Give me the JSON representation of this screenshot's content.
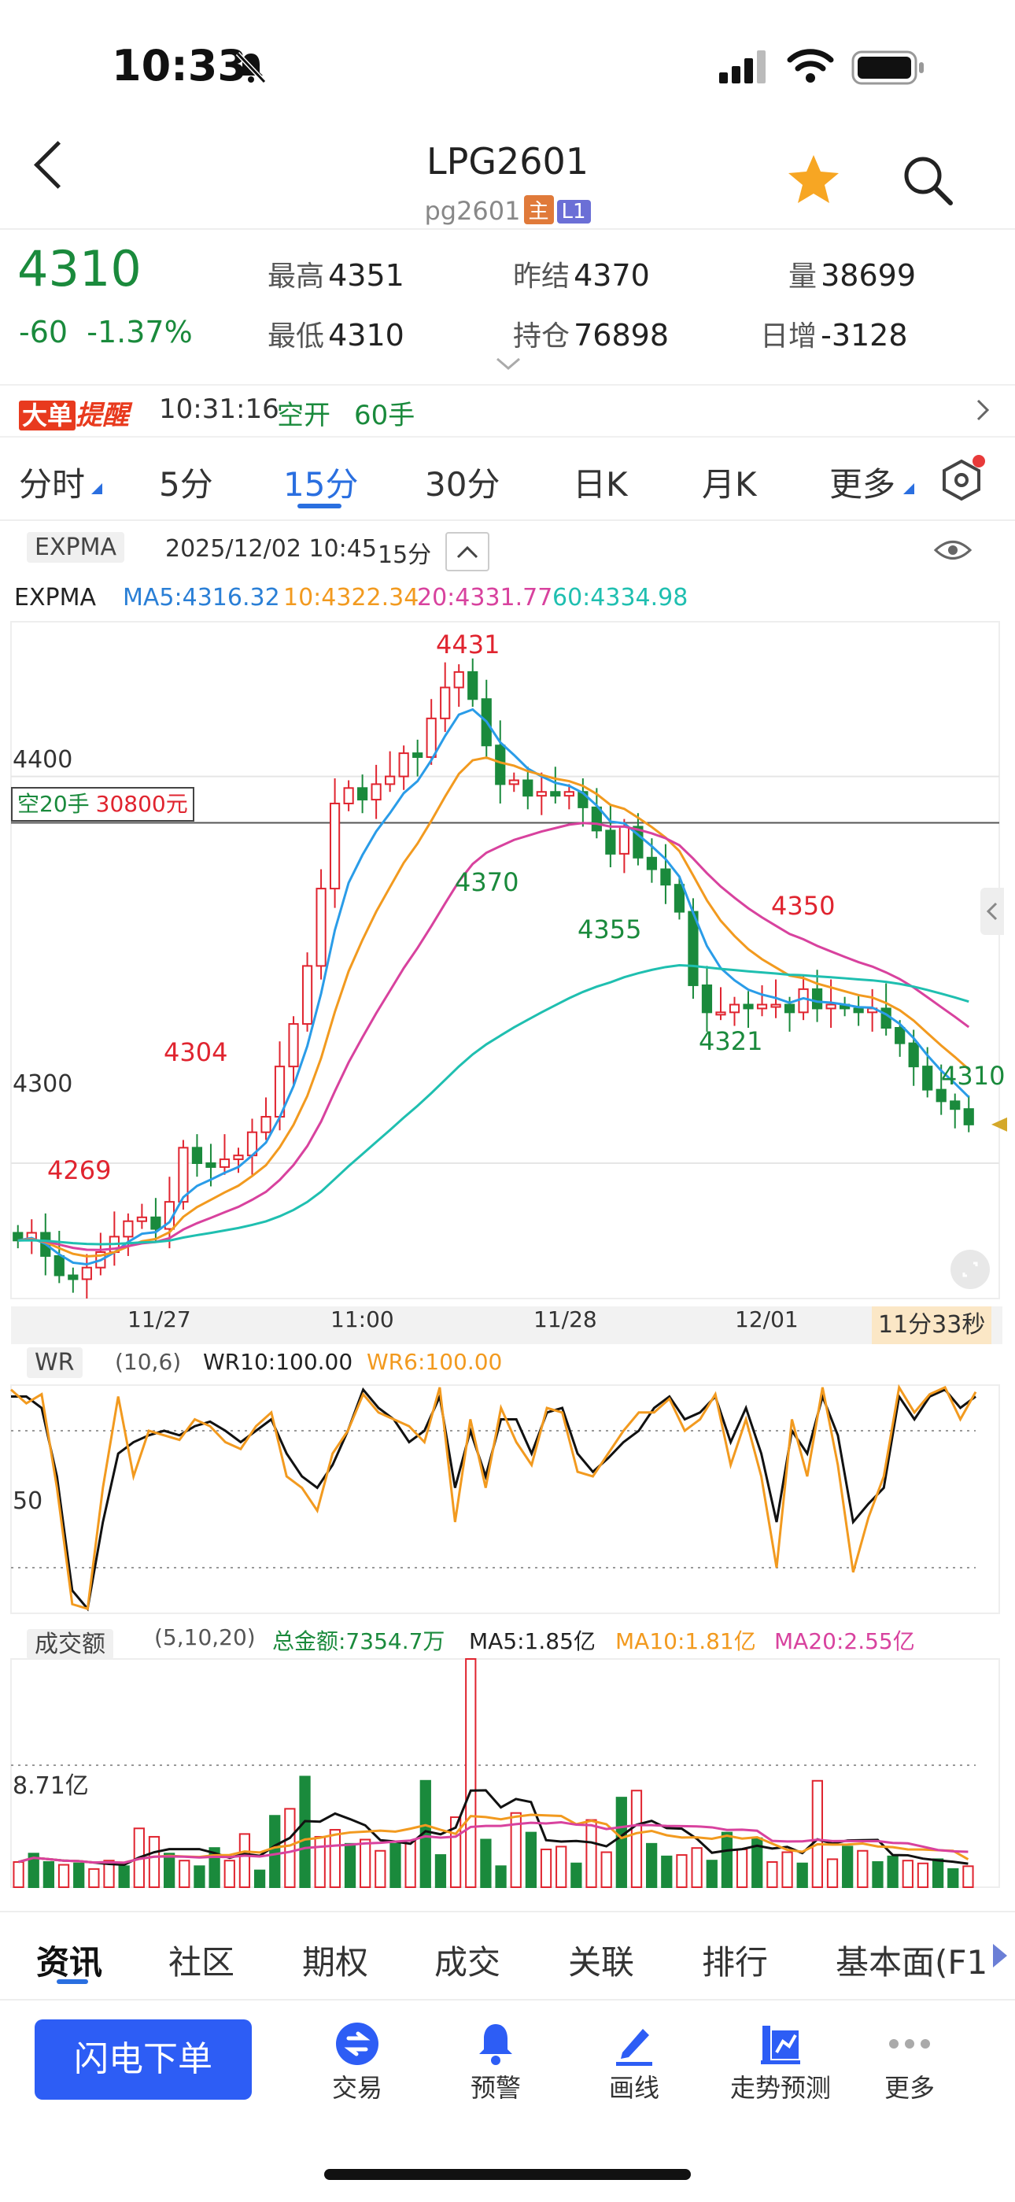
{
  "status_bar": {
    "time": "10:33"
  },
  "nav": {
    "title": "LPG2601",
    "subtitle": "pg2601",
    "tag_main": "主",
    "tag_l1": "L1"
  },
  "quote": {
    "price": "4310",
    "change": "-60",
    "change_pct": "-1.37%",
    "high_label": "最高",
    "high": "4351",
    "low_label": "最低",
    "low": "4310",
    "prev_settle_label": "昨结",
    "prev_settle": "4370",
    "open_interest_label": "持仓",
    "open_interest": "76898",
    "volume_label": "量",
    "volume": "38699",
    "daily_inc_label": "日增",
    "daily_inc": "-3128"
  },
  "alert": {
    "badge_a": "大单",
    "badge_b": "提醒",
    "time": "10:31:16",
    "action": "空开",
    "qty": "60手"
  },
  "tabs": [
    "分时",
    "5分",
    "15分",
    "30分",
    "日K",
    "月K",
    "更多"
  ],
  "active_tab": "15分",
  "indicator_bar": {
    "name": "EXPMA",
    "datetime": "2025/12/02 10:45",
    "period": "15分"
  },
  "expma_legend": {
    "label": "EXPMA",
    "ma5": "MA5:4316.32",
    "ma10": "10:4322.34",
    "ma20": "20:4331.77",
    "ma60": "60:4334.98"
  },
  "position_tag": {
    "text_a": "空20手",
    "text_b": "30800元"
  },
  "countdown": "11分33秒",
  "wr": {
    "name": "WR",
    "params": "(10,6)",
    "wr10": "WR10:100.00",
    "wr6": "WR6:100.00",
    "level": "50"
  },
  "vol": {
    "name": "成交额",
    "params": "(5,10,20)",
    "total": "总金额:7354.7万",
    "ma5": "MA5:1.85亿",
    "ma10": "MA10:1.81亿",
    "ma20": "MA20:2.55亿",
    "level": "8.71亿"
  },
  "info_tabs": [
    "资讯",
    "社区",
    "期权",
    "成交",
    "关联",
    "排行",
    "基本面(F1"
  ],
  "toolbar": {
    "flash": "闪电下单",
    "items": [
      "交易",
      "预警",
      "画线",
      "走势预测",
      "更多"
    ]
  },
  "colors": {
    "up": "#e0242f",
    "down": "#1a8a3c",
    "ma5": "#2a9ce8",
    "ma10": "#f29a1f",
    "ma20": "#d8429e",
    "ma60": "#1fbfb0",
    "accent": "#2d5df5"
  },
  "chart_data": {
    "type": "candlestick",
    "x_ticks": [
      "11/27",
      "11:00",
      "11/28",
      "12/01"
    ],
    "y_ticks": [
      4400,
      4300
    ],
    "ylim": [
      4265,
      4440
    ],
    "annotations": [
      "4269",
      "4304",
      "4431",
      "4370",
      "4355",
      "4350",
      "4321",
      "4310"
    ],
    "close_series": [
      4280,
      4282,
      4276,
      4271,
      4270,
      4273,
      4277,
      4281,
      4285,
      4286,
      4283,
      4290,
      4304,
      4300,
      4299,
      4301,
      4302,
      4308,
      4312,
      4325,
      4336,
      4351,
      4371,
      4393,
      4397,
      4394,
      4398,
      4400,
      4406,
      4405,
      4415,
      4423,
      4427,
      4420,
      4408,
      4398,
      4399,
      4395,
      4396,
      4395,
      4396,
      4392,
      4386,
      4380,
      4387,
      4379,
      4376,
      4372,
      4365,
      4346,
      4339,
      4339,
      4341,
      4340,
      4341,
      4341,
      4339,
      4345,
      4340,
      4341,
      4340,
      4339,
      4340,
      4335,
      4331,
      4325,
      4319,
      4316,
      4314,
      4310
    ],
    "wr": {
      "wr10": [
        95,
        95,
        90,
        60,
        10,
        2,
        40,
        70,
        75,
        78,
        80,
        78,
        82,
        84,
        80,
        75,
        80,
        85,
        70,
        60,
        55,
        65,
        80,
        98,
        90,
        85,
        75,
        80,
        95,
        55,
        80,
        60,
        85,
        85,
        70,
        88,
        90,
        70,
        62,
        68,
        75,
        80,
        90,
        95,
        85,
        88,
        95,
        75,
        90,
        70,
        40,
        80,
        70,
        95,
        78,
        40,
        48,
        55,
        95,
        85,
        95,
        98,
        90,
        95
      ],
      "wr6": [
        98,
        92,
        96,
        55,
        4,
        2,
        55,
        95,
        60,
        80,
        78,
        76,
        85,
        82,
        75,
        72,
        82,
        88,
        60,
        55,
        45,
        70,
        80,
        96,
        88,
        85,
        82,
        75,
        99,
        40,
        85,
        55,
        90,
        75,
        65,
        90,
        88,
        62,
        60,
        70,
        80,
        88,
        88,
        94,
        80,
        85,
        96,
        65,
        85,
        60,
        20,
        85,
        60,
        99,
        65,
        18,
        42,
        60,
        99,
        88,
        96,
        99,
        85,
        97
      ]
    },
    "volume": {
      "values": [
        1.8,
        2.4,
        1.8,
        1.6,
        1.7,
        1.3,
        1.9,
        1.5,
        4.2,
        3.6,
        2.4,
        1.9,
        1.5,
        2.8,
        1.9,
        3.8,
        1.2,
        5.1,
        5.6,
        7.9,
        3.6,
        4.1,
        3.1,
        3.4,
        2.6,
        3.1,
        3.3,
        7.6,
        2.3,
        5.0,
        16.3,
        3.4,
        1.5,
        5.3,
        3.9,
        2.7,
        2.9,
        1.7,
        4.8,
        2.5,
        6.4,
        6.9,
        3.1,
        2.2,
        2.3,
        2.8,
        1.9,
        3.9,
        2.7,
        3.5,
        1.8,
        2.5,
        1.7,
        7.6,
        2.0,
        2.9,
        2.6,
        1.8,
        2.2,
        1.9,
        1.7,
        2.0,
        1.3,
        1.5
      ]
    }
  }
}
